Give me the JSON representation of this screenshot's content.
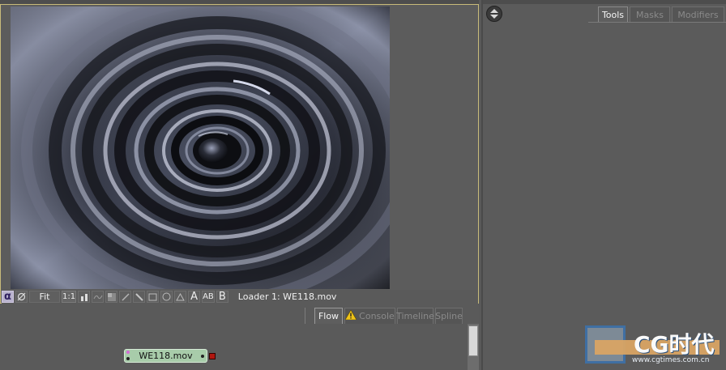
{
  "viewer": {
    "toolbar": {
      "alpha_label": "α",
      "fit_label": "Fit",
      "ratio_label": "1:1",
      "text_tool_a": "A",
      "text_tool_ab": "AB",
      "text_tool_b": "B"
    },
    "status": "Loader 1: WE118.mov"
  },
  "right_panel": {
    "tabs": [
      {
        "label": "Tools",
        "active": true
      },
      {
        "label": "Masks",
        "active": false
      },
      {
        "label": "Modifiers",
        "active": false
      }
    ]
  },
  "flow_panel": {
    "tabs": [
      {
        "label": "Flow",
        "active": true
      },
      {
        "label": "Console",
        "active": false
      },
      {
        "label": "Timeline",
        "active": false
      },
      {
        "label": "Spline",
        "active": false
      }
    ],
    "node": {
      "label": "WE118.mov",
      "accent": "#a8ccaa",
      "output_color": "#b0160f"
    }
  },
  "watermark": {
    "logo_text": "CG时代",
    "url": "www.cgtimes.com.cn"
  },
  "colors": {
    "viewer_border": "#c8bb7a",
    "background": "#595959",
    "warning_icon": "#f0c419"
  }
}
